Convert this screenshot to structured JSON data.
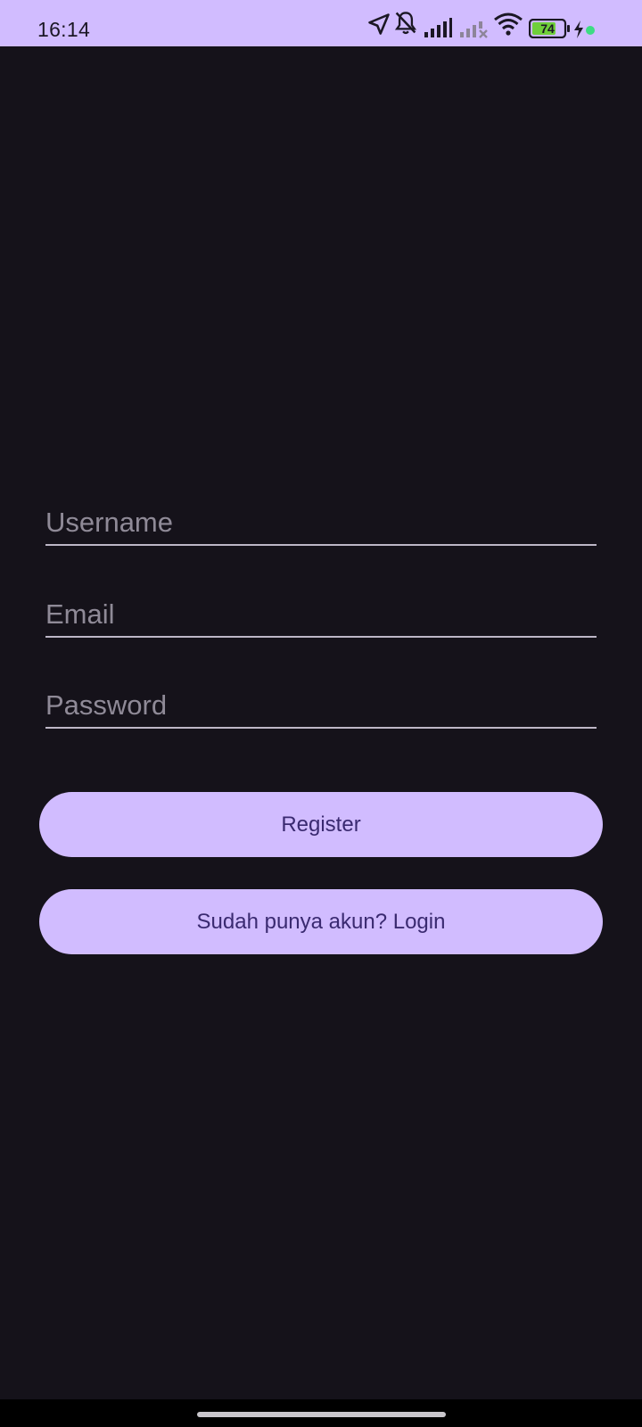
{
  "status_bar": {
    "time": "16:14",
    "battery_level": "74",
    "icons": [
      "navigation-arrow-icon",
      "bell-off-icon",
      "signal-icon",
      "signal-no-service-icon",
      "wifi-icon",
      "battery-icon",
      "charging-bolt-icon",
      "privacy-dot-icon"
    ]
  },
  "form": {
    "username_placeholder": "Username",
    "username_value": "",
    "email_placeholder": "Email",
    "email_value": "",
    "password_placeholder": "Password",
    "password_value": ""
  },
  "actions": {
    "register_label": "Register",
    "login_label": "Sudah punya akun? Login"
  },
  "colors": {
    "background": "#15121a",
    "accent": "#d1bcff",
    "button_text": "#3a2a70",
    "battery_fill": "#6fcf3a",
    "privacy_dot": "#3ddc84"
  }
}
